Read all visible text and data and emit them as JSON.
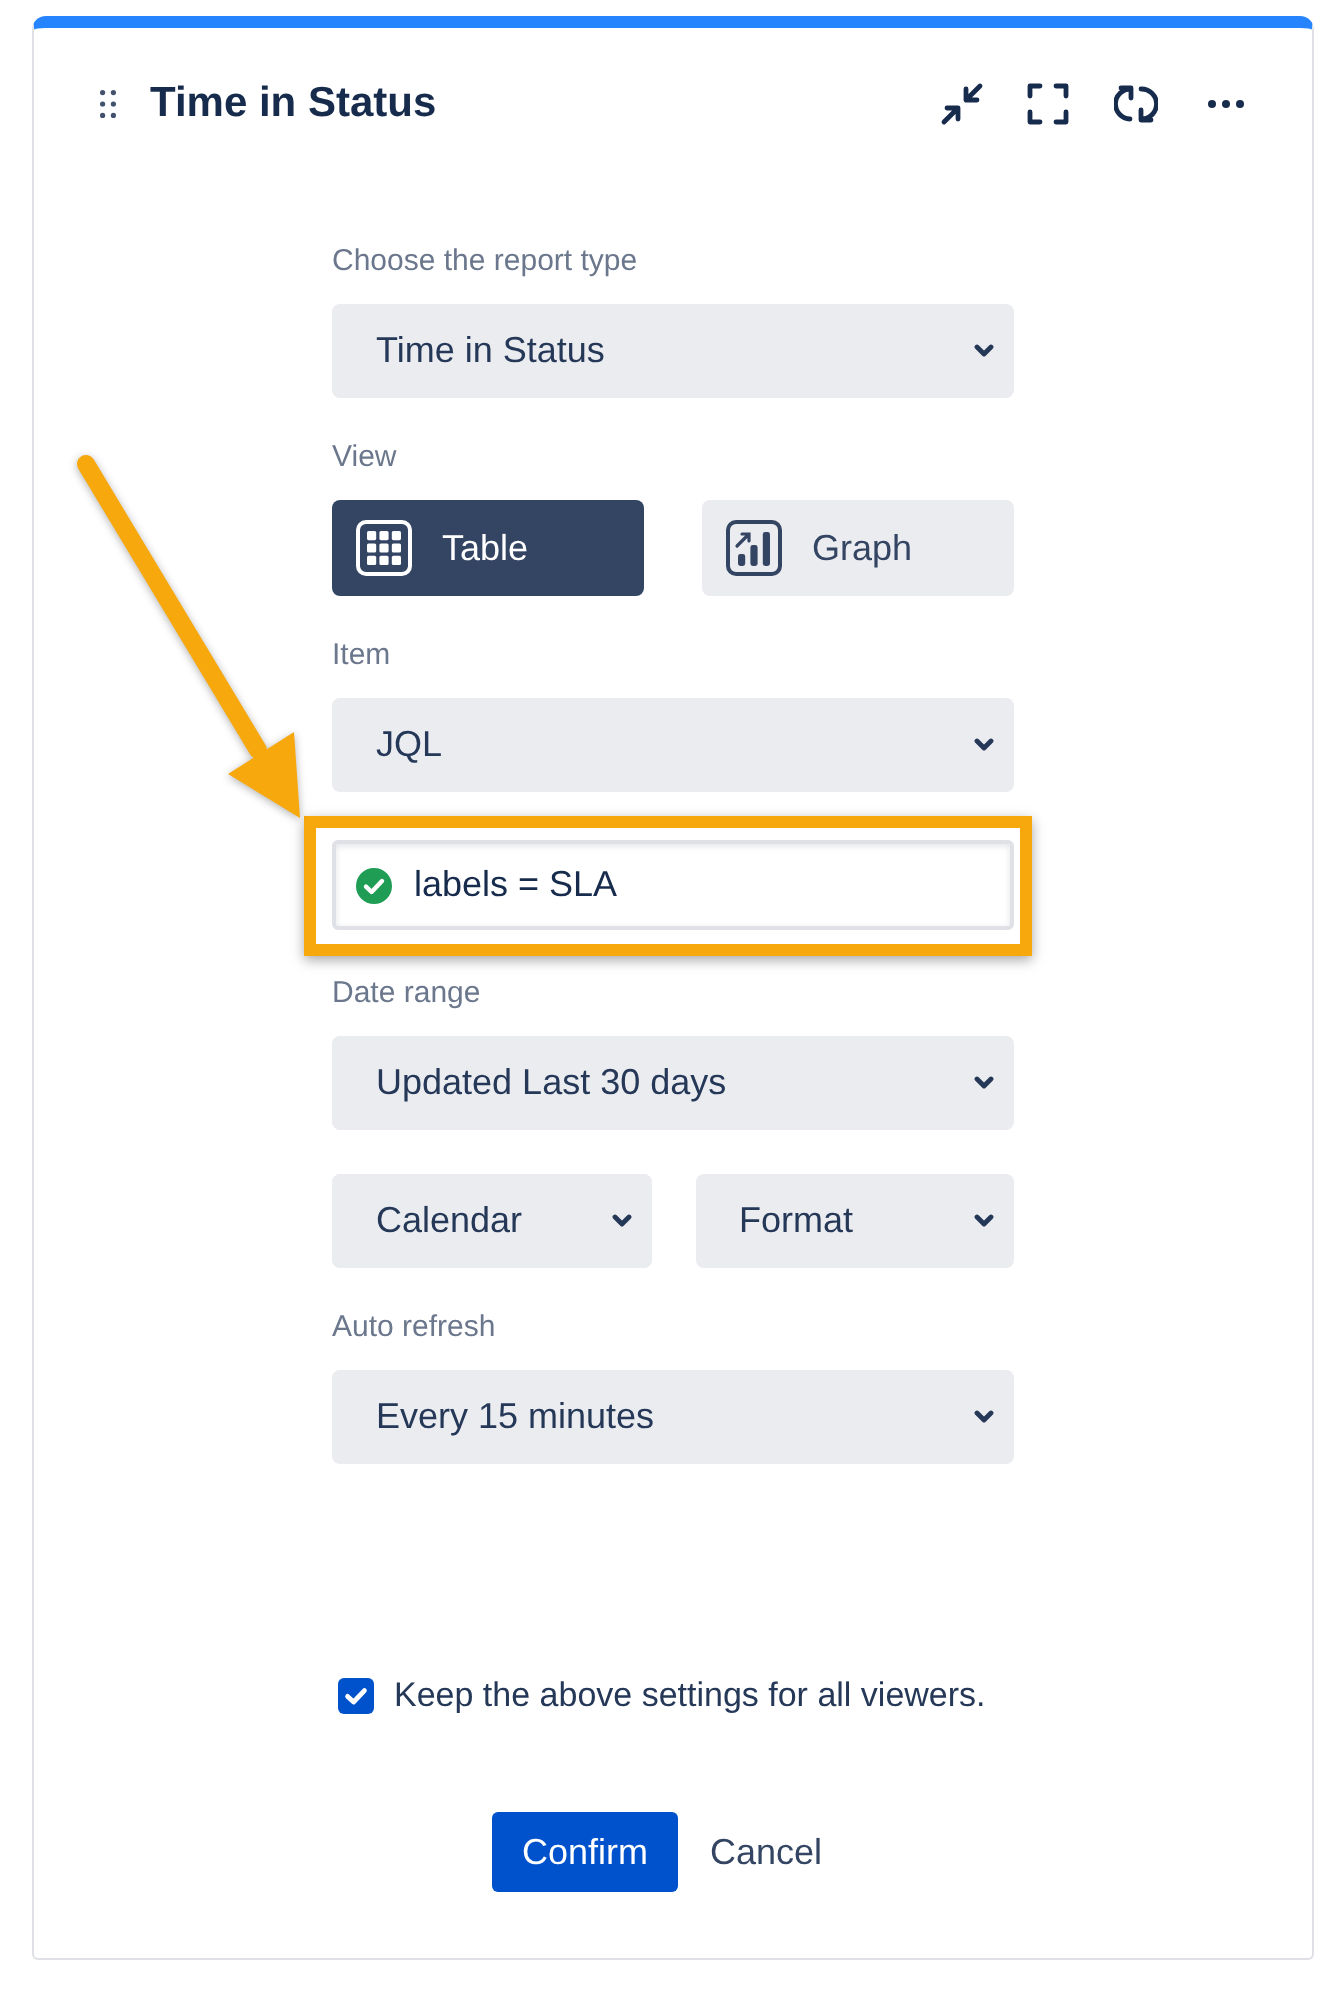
{
  "widget": {
    "title": "Time in Status"
  },
  "form": [
    {
      "kind": "select",
      "label": "Choose the report type",
      "value": "Time in Status"
    },
    {
      "kind": "toggle",
      "label": "View",
      "options": [
        {
          "label": "Table",
          "selected": true
        },
        {
          "label": "Graph",
          "selected": false
        }
      ]
    },
    {
      "kind": "select",
      "label": "Item",
      "value": "JQL"
    },
    {
      "kind": "query",
      "value": "labels = SLA",
      "valid": true,
      "highlighted": true
    },
    {
      "kind": "select",
      "label": "Date range",
      "value": "Updated Last 30 days"
    },
    {
      "kind": "select_row",
      "selects": [
        {
          "value": "Calendar"
        },
        {
          "value": "Format"
        }
      ]
    },
    {
      "kind": "select",
      "label": "Auto refresh",
      "value": "Every 15 minutes"
    }
  ],
  "keep_settings": {
    "label": "Keep the above settings for all viewers.",
    "checked": true
  },
  "buttons": [
    {
      "kind": "primary",
      "label": "Confirm"
    },
    {
      "kind": "subtle",
      "label": "Cancel"
    }
  ]
}
